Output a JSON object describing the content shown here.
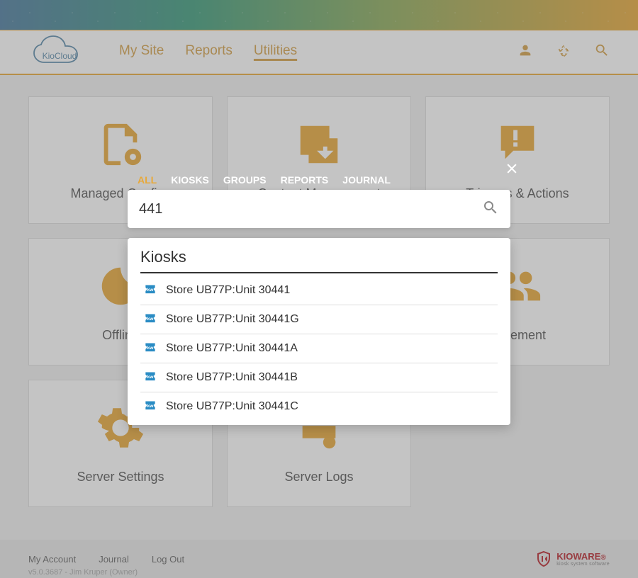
{
  "brand": "KioCloud",
  "nav": {
    "items": [
      "My Site",
      "Reports",
      "Utilities"
    ],
    "active_index": 2
  },
  "cards": [
    {
      "label": "Managed Configs"
    },
    {
      "label": "Content Management"
    },
    {
      "label": "Triggers & Actions"
    },
    {
      "label": "Offline"
    },
    {
      "label": ""
    },
    {
      "label": "nagement"
    },
    {
      "label": "Server Settings"
    },
    {
      "label": "Server Logs"
    }
  ],
  "footer": {
    "links": [
      "My Account",
      "Journal",
      "Log Out"
    ],
    "meta": "v5.0.3687 - Jim Kruper (Owner)",
    "brand": "KIOWARE",
    "brand_sub": "kiosk system software"
  },
  "search": {
    "tabs": [
      "ALL",
      "KIOSKS",
      "GROUPS",
      "REPORTS",
      "JOURNAL"
    ],
    "active_tab_index": 0,
    "value": "441",
    "results_title": "Kiosks",
    "results": [
      "Store UB77P:Unit 30441",
      "Store UB77P:Unit 30441G",
      "Store UB77P:Unit 30441A",
      "Store UB77P:Unit 30441B",
      "Store UB77P:Unit 30441C"
    ]
  }
}
